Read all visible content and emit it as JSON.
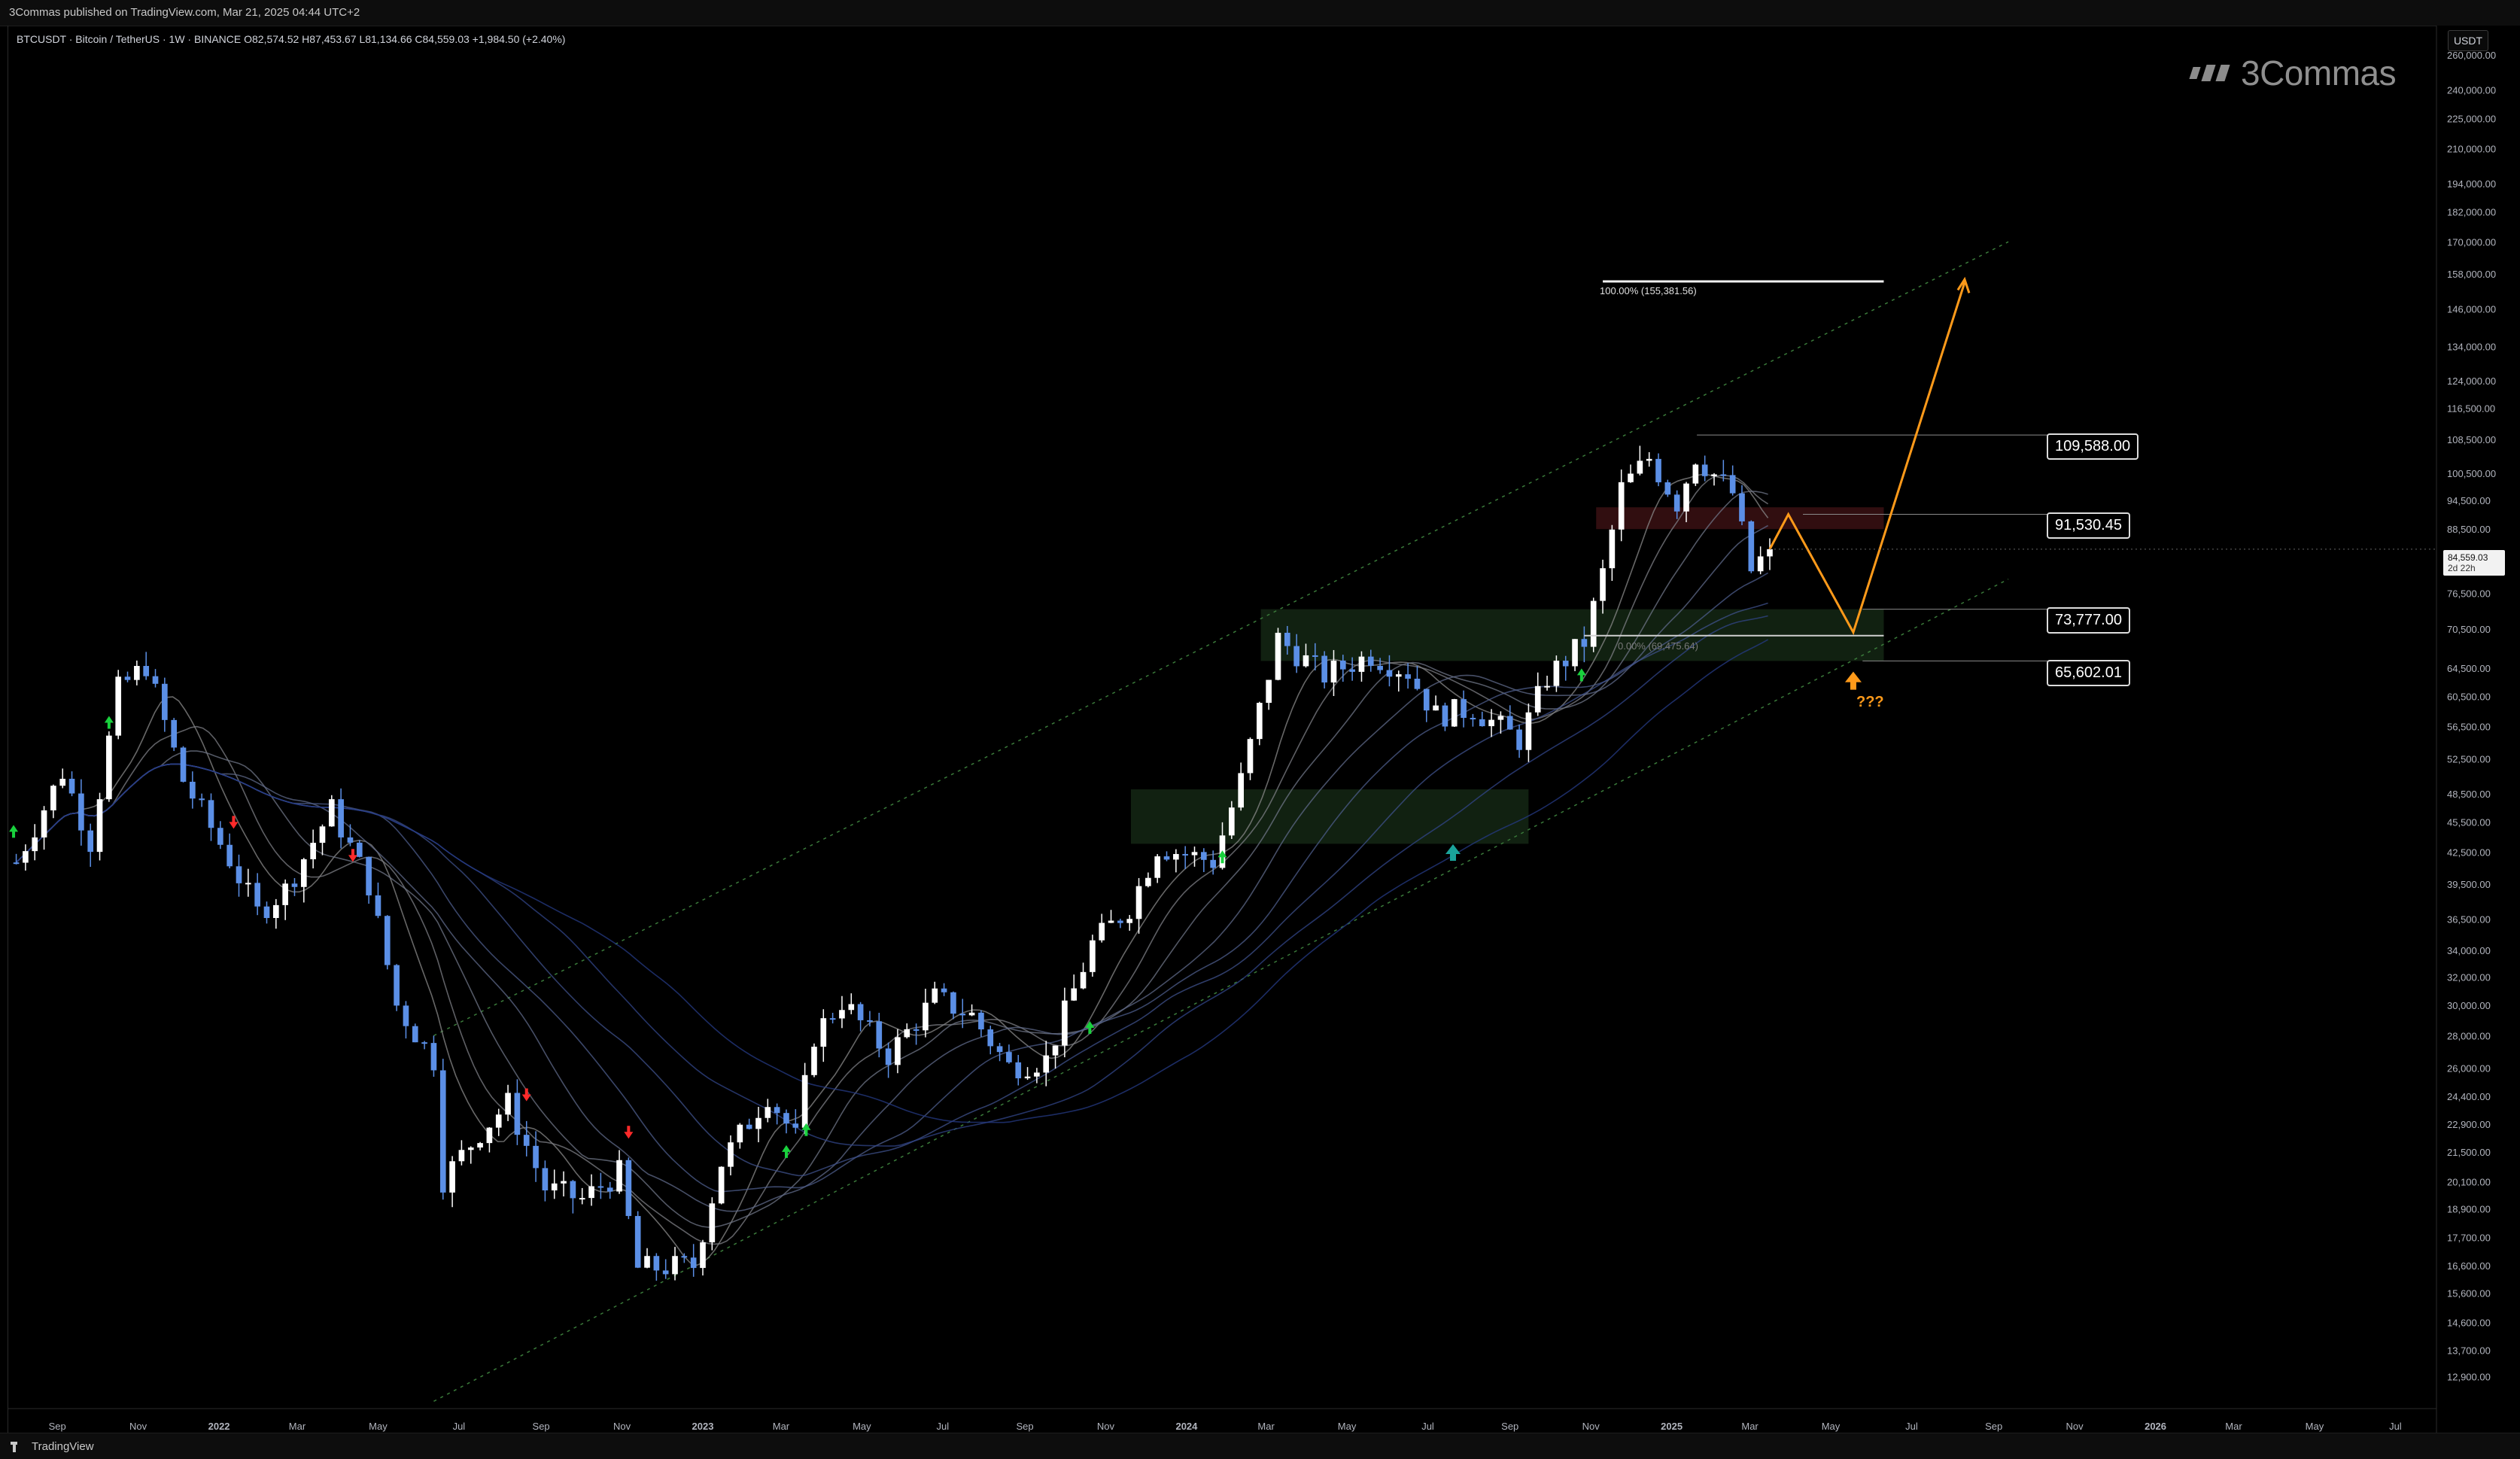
{
  "header": {
    "published": "3Commas published on TradingView.com, Mar 21, 2025 04:44 UTC+2",
    "symbol_line": "BTCUSDT · Bitcoin / TetherUS · 1W · BINANCE  O82,574.52  H87,453.67  L81,134.66  C84,559.03  +1,984.50 (+2.40%)"
  },
  "brand": {
    "name": "3Commas"
  },
  "currency_badge": "USDT",
  "footer": {
    "logo_text": "TradingView"
  },
  "chart_data": {
    "type": "candlestick",
    "title": "BTCUSDT · Bitcoin / TetherUS · 1W · BINANCE",
    "scale": "log",
    "ylim": [
      12000,
      275000
    ],
    "xlim": [
      "2021-07-26",
      "2026-08-01"
    ],
    "grid": false,
    "y_ticks": [
      "260,000.00",
      "240,000.00",
      "225,000.00",
      "210,000.00",
      "194,000.00",
      "182,000.00",
      "170,000.00",
      "158,000.00",
      "146,000.00",
      "134,000.00",
      "124,000.00",
      "116,500.00",
      "108,500.00",
      "100,500.00",
      "94,500.00",
      "88,500.00",
      "76,500.00",
      "70,500.00",
      "64,500.00",
      "60,500.00",
      "56,500.00",
      "52,500.00",
      "48,500.00",
      "45,500.00",
      "42,500.00",
      "39,500.00",
      "36,500.00",
      "34,000.00",
      "32,000.00",
      "30,000.00",
      "28,000.00",
      "26,000.00",
      "24,400.00",
      "22,900.00",
      "21,500.00",
      "20,100.00",
      "18,900.00",
      "17,700.00",
      "16,600.00",
      "15,600.00",
      "14,600.00",
      "13,700.00",
      "12,900.00"
    ],
    "x_ticks": [
      {
        "label": "Sep",
        "date": "2021-09-01"
      },
      {
        "label": "Nov",
        "date": "2021-11-01"
      },
      {
        "label": "2022",
        "date": "2022-01-01",
        "bold": true
      },
      {
        "label": "Mar",
        "date": "2022-03-01"
      },
      {
        "label": "May",
        "date": "2022-05-01"
      },
      {
        "label": "Jul",
        "date": "2022-07-01"
      },
      {
        "label": "Sep",
        "date": "2022-09-01"
      },
      {
        "label": "Nov",
        "date": "2022-11-01"
      },
      {
        "label": "2023",
        "date": "2023-01-01",
        "bold": true
      },
      {
        "label": "Mar",
        "date": "2023-03-01"
      },
      {
        "label": "May",
        "date": "2023-05-01"
      },
      {
        "label": "Jul",
        "date": "2023-07-01"
      },
      {
        "label": "Sep",
        "date": "2023-09-01"
      },
      {
        "label": "Nov",
        "date": "2023-11-01"
      },
      {
        "label": "2024",
        "date": "2024-01-01",
        "bold": true
      },
      {
        "label": "Mar",
        "date": "2024-03-01"
      },
      {
        "label": "May",
        "date": "2024-05-01"
      },
      {
        "label": "Jul",
        "date": "2024-07-01"
      },
      {
        "label": "Sep",
        "date": "2024-09-01"
      },
      {
        "label": "Nov",
        "date": "2024-11-01"
      },
      {
        "label": "2025",
        "date": "2025-01-01",
        "bold": true
      },
      {
        "label": "Mar",
        "date": "2025-03-01"
      },
      {
        "label": "May",
        "date": "2025-05-01"
      },
      {
        "label": "Jul",
        "date": "2025-07-01"
      },
      {
        "label": "Sep",
        "date": "2025-09-01"
      },
      {
        "label": "Nov",
        "date": "2025-11-01"
      },
      {
        "label": "2026",
        "date": "2026-01-01",
        "bold": true
      },
      {
        "label": "Mar",
        "date": "2026-03-01"
      },
      {
        "label": "May",
        "date": "2026-05-01"
      },
      {
        "label": "Jul",
        "date": "2026-07-01"
      }
    ],
    "closes": [
      {
        "date": "2021-08-01",
        "close": 41500
      },
      {
        "date": "2021-09-05",
        "close": 51000
      },
      {
        "date": "2021-09-26",
        "close": 43500
      },
      {
        "date": "2021-10-17",
        "close": 61500
      },
      {
        "date": "2021-11-07",
        "close": 65000
      },
      {
        "date": "2021-12-05",
        "close": 50000
      },
      {
        "date": "2022-01-09",
        "close": 41800
      },
      {
        "date": "2022-01-30",
        "close": 37000
      },
      {
        "date": "2022-02-20",
        "close": 39000
      },
      {
        "date": "2022-03-27",
        "close": 46800
      },
      {
        "date": "2022-04-24",
        "close": 39500
      },
      {
        "date": "2022-05-15",
        "close": 30000
      },
      {
        "date": "2022-06-12",
        "close": 26500
      },
      {
        "date": "2022-06-19",
        "close": 20200
      },
      {
        "date": "2022-07-17",
        "close": 22500
      },
      {
        "date": "2022-08-07",
        "close": 24000
      },
      {
        "date": "2022-09-04",
        "close": 19800
      },
      {
        "date": "2022-10-02",
        "close": 19300
      },
      {
        "date": "2022-10-30",
        "close": 20500
      },
      {
        "date": "2022-11-13",
        "close": 16500
      },
      {
        "date": "2022-12-25",
        "close": 16600
      },
      {
        "date": "2023-01-15",
        "close": 21000
      },
      {
        "date": "2023-02-19",
        "close": 24500
      },
      {
        "date": "2023-03-12",
        "close": 22200
      },
      {
        "date": "2023-03-26",
        "close": 28000
      },
      {
        "date": "2023-04-16",
        "close": 30300
      },
      {
        "date": "2023-05-21",
        "close": 26800
      },
      {
        "date": "2023-06-25",
        "close": 30500
      },
      {
        "date": "2023-07-23",
        "close": 29300
      },
      {
        "date": "2023-08-20",
        "close": 26100
      },
      {
        "date": "2023-09-17",
        "close": 26500
      },
      {
        "date": "2023-10-22",
        "close": 34500
      },
      {
        "date": "2023-11-19",
        "close": 37500
      },
      {
        "date": "2023-12-10",
        "close": 43000
      },
      {
        "date": "2024-01-21",
        "close": 41600
      },
      {
        "date": "2024-02-11",
        "close": 50000
      },
      {
        "date": "2024-03-10",
        "close": 69000
      },
      {
        "date": "2024-04-14",
        "close": 63500
      },
      {
        "date": "2024-05-19",
        "close": 66500
      },
      {
        "date": "2024-06-16",
        "close": 64000
      },
      {
        "date": "2024-07-07",
        "close": 58000
      },
      {
        "date": "2024-08-04",
        "close": 58800
      },
      {
        "date": "2024-09-08",
        "close": 54800
      },
      {
        "date": "2024-09-29",
        "close": 63200
      },
      {
        "date": "2024-10-27",
        "close": 68500
      },
      {
        "date": "2024-11-10",
        "close": 80000
      },
      {
        "date": "2024-11-24",
        "close": 97000
      },
      {
        "date": "2024-12-15",
        "close": 104000
      },
      {
        "date": "2025-01-05",
        "close": 94000
      },
      {
        "date": "2025-01-19",
        "close": 104500
      },
      {
        "date": "2025-02-16",
        "close": 96000
      },
      {
        "date": "2025-03-02",
        "close": 80500
      },
      {
        "date": "2025-03-16",
        "close": 84559.03
      }
    ],
    "levels": [
      {
        "label": "109,588.00",
        "value": 109588
      },
      {
        "label": "91,530.45",
        "value": 91530.45
      },
      {
        "label": "73,777.00",
        "value": 73777
      },
      {
        "label": "65,602.01",
        "value": 65602.01
      }
    ],
    "fib": {
      "label_100": "100.00% (155,381.56)",
      "value_100": 155381.56,
      "label_0": "0.00% (69,475.64)",
      "value_0": 69475.64
    },
    "last_price": {
      "value": "84,559.03",
      "countdown": "2d 22h"
    },
    "annotation": "???",
    "colors": {
      "bull": "#ffffff",
      "bear": "#5b8fe6",
      "projection": "#ff9a1a",
      "support_zone": "#1f3d1f",
      "resistance_zone": "#5a1a1e",
      "channel": "#3a7a3a"
    }
  }
}
